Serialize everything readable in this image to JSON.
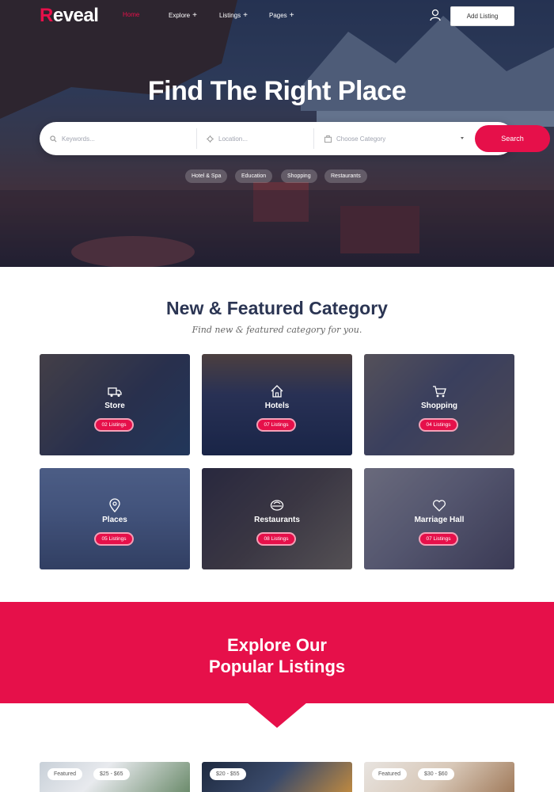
{
  "brand": {
    "logo_initial": "R",
    "logo_rest": "eveal",
    "accent": "#e6104a"
  },
  "nav": {
    "items": [
      {
        "label": "Home",
        "active": true
      },
      {
        "label": "Explore",
        "plus": "+"
      },
      {
        "label": "Listings",
        "plus": "+"
      },
      {
        "label": "Pages",
        "plus": "+"
      }
    ],
    "add_listing": "Add Listing"
  },
  "hero": {
    "title": "Find The Right Place",
    "search": {
      "keywords_placeholder": "Keywords...",
      "location_placeholder": "Location...",
      "category_placeholder": "Choose Category",
      "button": "Search"
    },
    "tags": [
      "Hotel & Spa",
      "Education",
      "Shopping",
      "Restaurants"
    ]
  },
  "categories": {
    "title": "New & Featured Category",
    "subtitle": "Find new & featured category for you.",
    "items": [
      {
        "name": "Store",
        "count": "02 Listings",
        "icon": "truck-icon"
      },
      {
        "name": "Hotels",
        "count": "07 Listings",
        "icon": "home-icon"
      },
      {
        "name": "Shopping",
        "count": "04 Listings",
        "icon": "cart-icon"
      },
      {
        "name": "Places",
        "count": "05 Listings",
        "icon": "map-pin-icon"
      },
      {
        "name": "Restaurants",
        "count": "08 Listings",
        "icon": "dish-icon"
      },
      {
        "name": "Marriage Hall",
        "count": "07 Listings",
        "icon": "heart-icon"
      }
    ]
  },
  "popular": {
    "title_line1": "Explore Our",
    "title_line2": "Popular Listings",
    "cards": [
      {
        "featured": "Featured",
        "price": "$25 - $65"
      },
      {
        "featured": "",
        "price": "$20 - $55"
      },
      {
        "featured": "Featured",
        "price": "$30 - $60"
      }
    ]
  }
}
